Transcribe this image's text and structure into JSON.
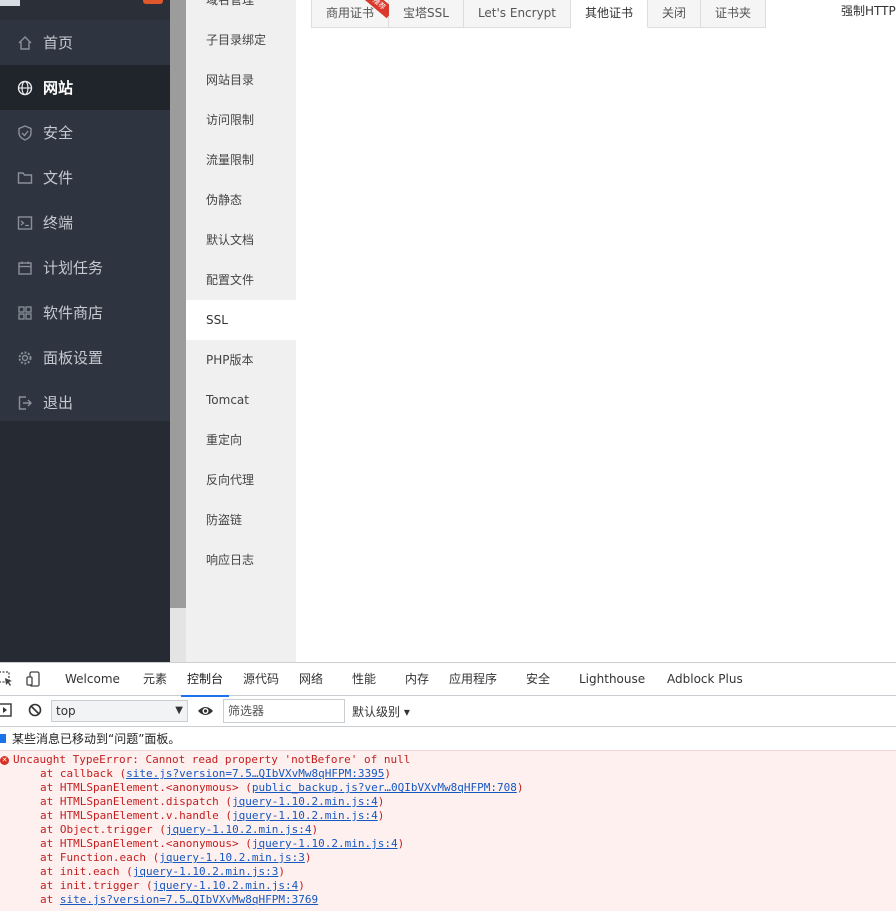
{
  "sidenav": {
    "items": [
      {
        "label": "首页",
        "icon": "home-icon"
      },
      {
        "label": "网站",
        "icon": "globe-icon",
        "active": true
      },
      {
        "label": "安全",
        "icon": "shield-icon"
      },
      {
        "label": "文件",
        "icon": "folder-icon"
      },
      {
        "label": "终端",
        "icon": "terminal-icon"
      },
      {
        "label": "计划任务",
        "icon": "calendar-icon"
      },
      {
        "label": "软件商店",
        "icon": "grid-icon"
      },
      {
        "label": "面板设置",
        "icon": "gear-icon"
      },
      {
        "label": "退出",
        "icon": "logout-icon"
      }
    ]
  },
  "submenu": {
    "items": [
      "域名管理",
      "子目录绑定",
      "网站目录",
      "访问限制",
      "流量限制",
      "伪静态",
      "默认文档",
      "配置文件",
      "SSL",
      "PHP版本",
      "Tomcat",
      "重定向",
      "反向代理",
      "防盗链",
      "响应日志"
    ],
    "active_index": 8
  },
  "ssl_tabs": {
    "tabs": [
      "商用证书",
      "宝塔SSL",
      "Let's Encrypt",
      "其他证书",
      "关闭",
      "证书夹"
    ],
    "active_index": 3,
    "ribbon": "推荐"
  },
  "force_https_label": "强制HTTPS",
  "devtools": {
    "tabs": [
      "Welcome",
      "元素",
      "控制台",
      "源代码",
      "网络",
      "性能",
      "内存",
      "应用程序",
      "安全",
      "Lighthouse",
      "Adblock Plus"
    ],
    "active_tab": "控制台",
    "context": "top",
    "filter_placeholder": "筛选器",
    "level": "默认级别",
    "moved_message": "某些消息已移动到“问题”面板。",
    "error": {
      "message": "Uncaught TypeError: Cannot read property 'notBefore' of null",
      "frames": [
        {
          "prefix": "at callback (",
          "src": "site.js?version=7.5…QIbVXvMw8qHFPM:3395",
          "suffix": ")"
        },
        {
          "prefix": "at HTMLSpanElement.<anonymous> (",
          "src": "public_backup.js?ver…0QIbVXvMw8qHFPM:708",
          "suffix": ")"
        },
        {
          "prefix": "at HTMLSpanElement.dispatch (",
          "src": "jquery-1.10.2.min.js:4",
          "suffix": ")"
        },
        {
          "prefix": "at HTMLSpanElement.v.handle (",
          "src": "jquery-1.10.2.min.js:4",
          "suffix": ")"
        },
        {
          "prefix": "at Object.trigger (",
          "src": "jquery-1.10.2.min.js:4",
          "suffix": ")"
        },
        {
          "prefix": "at HTMLSpanElement.<anonymous> (",
          "src": "jquery-1.10.2.min.js:4",
          "suffix": ")"
        },
        {
          "prefix": "at Function.each (",
          "src": "jquery-1.10.2.min.js:3",
          "suffix": ")"
        },
        {
          "prefix": "at init.each (",
          "src": "jquery-1.10.2.min.js:3",
          "suffix": ")"
        },
        {
          "prefix": "at init.trigger (",
          "src": "jquery-1.10.2.min.js:4",
          "suffix": ")"
        },
        {
          "prefix": "at ",
          "src": "site.js?version=7.5…QIbVXvMw8qHFPM:3769",
          "suffix": ""
        }
      ]
    }
  }
}
